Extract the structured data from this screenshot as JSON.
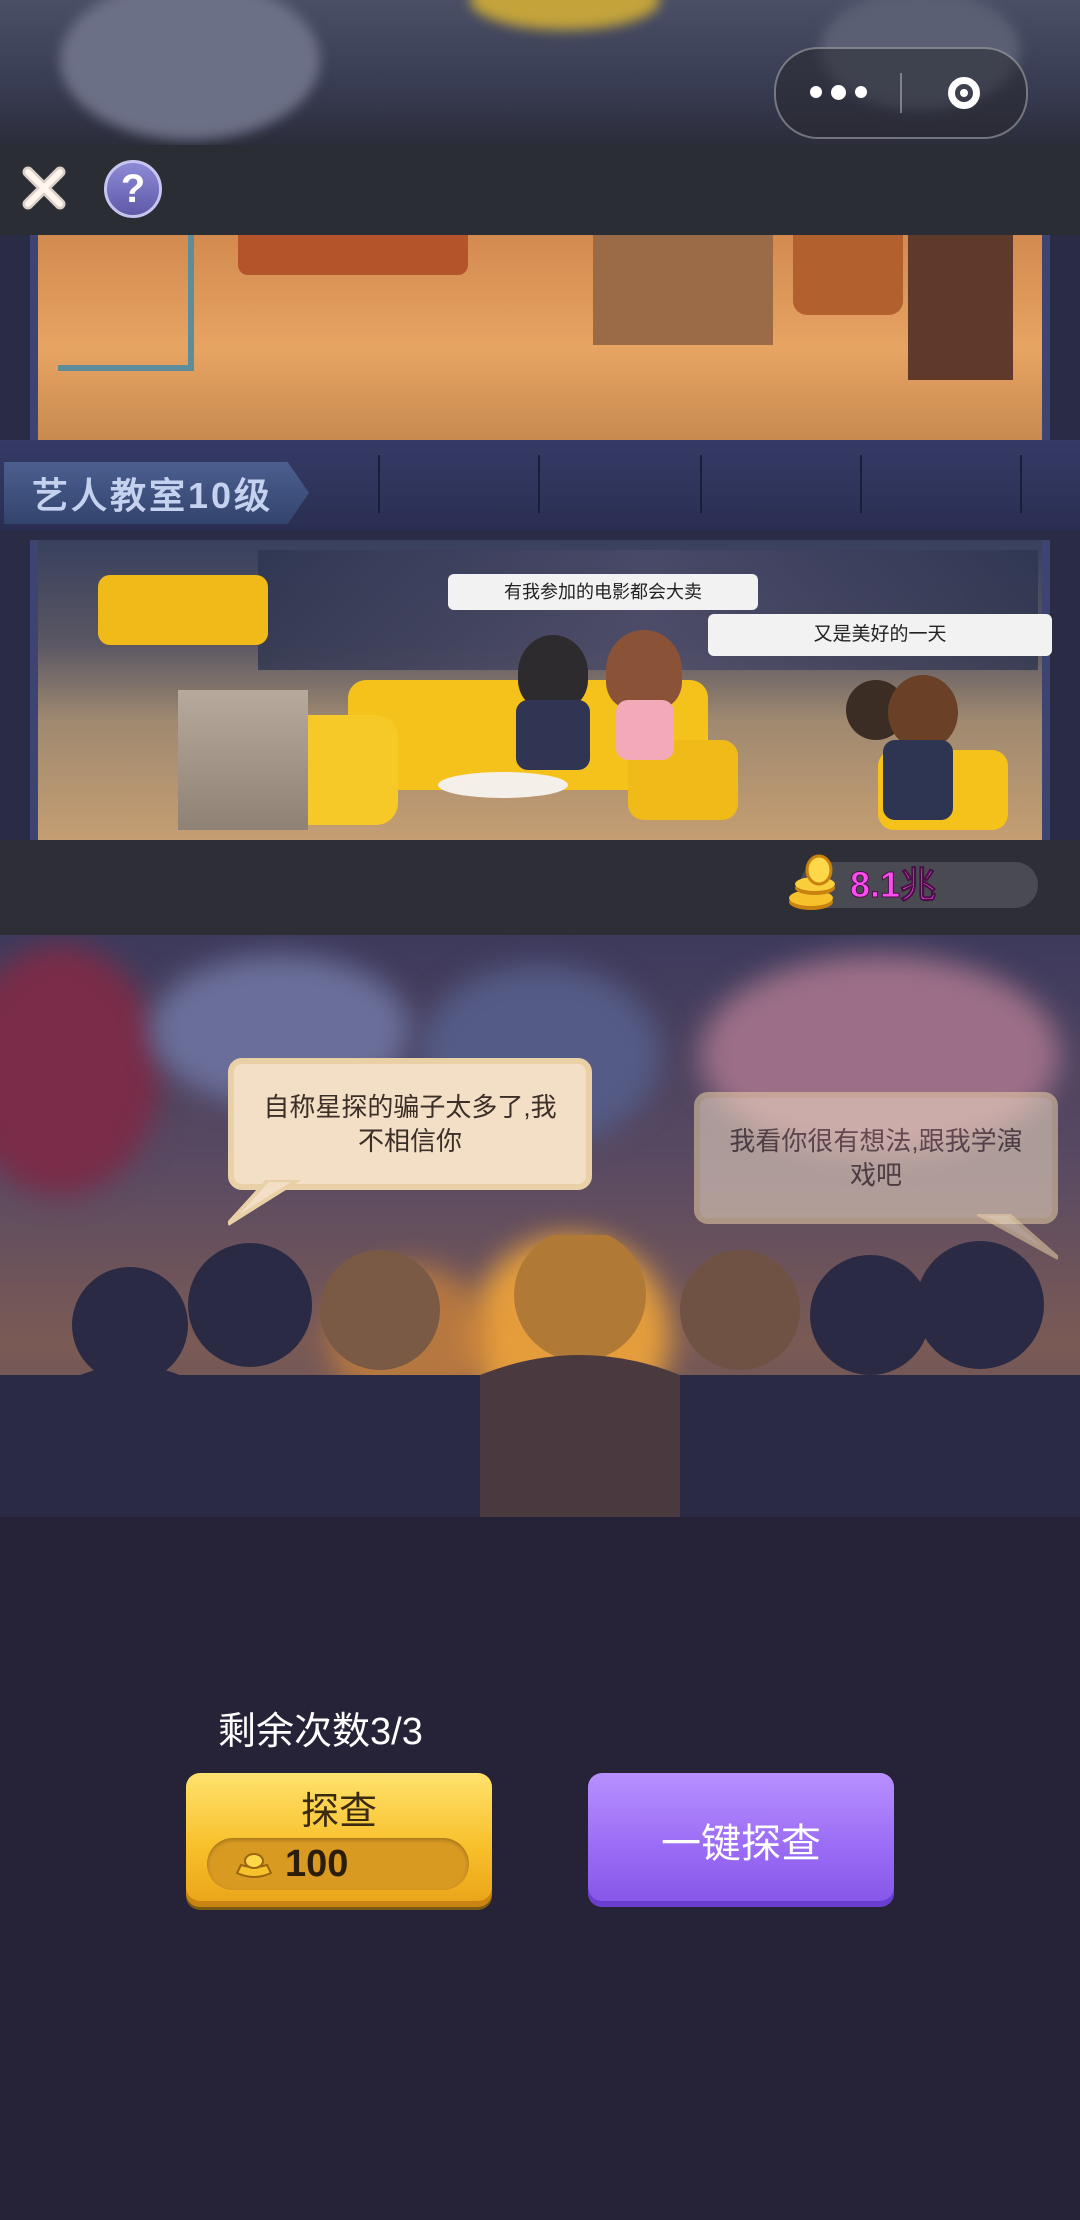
{
  "system_capsule": {
    "more_icon": "three-dots-icon",
    "close_icon": "target-circle-icon"
  },
  "toolbar": {
    "close_icon": "close-x-icon",
    "help_symbol": "?"
  },
  "building": {
    "level_label": "艺人教室10级",
    "bubbles": [
      "有我参加的电影都会大卖",
      "又是美好的一天"
    ],
    "money": "8.1兆"
  },
  "scout_scene": {
    "speech_left": "自称星探的骗子太多了,我不相信你",
    "speech_right": "我看你很有想法,跟我学演戏吧"
  },
  "actions": {
    "remaining": "剩余次数3/3",
    "scout_label": "探查",
    "scout_cost": "100",
    "one_click_label": "一键探查"
  }
}
